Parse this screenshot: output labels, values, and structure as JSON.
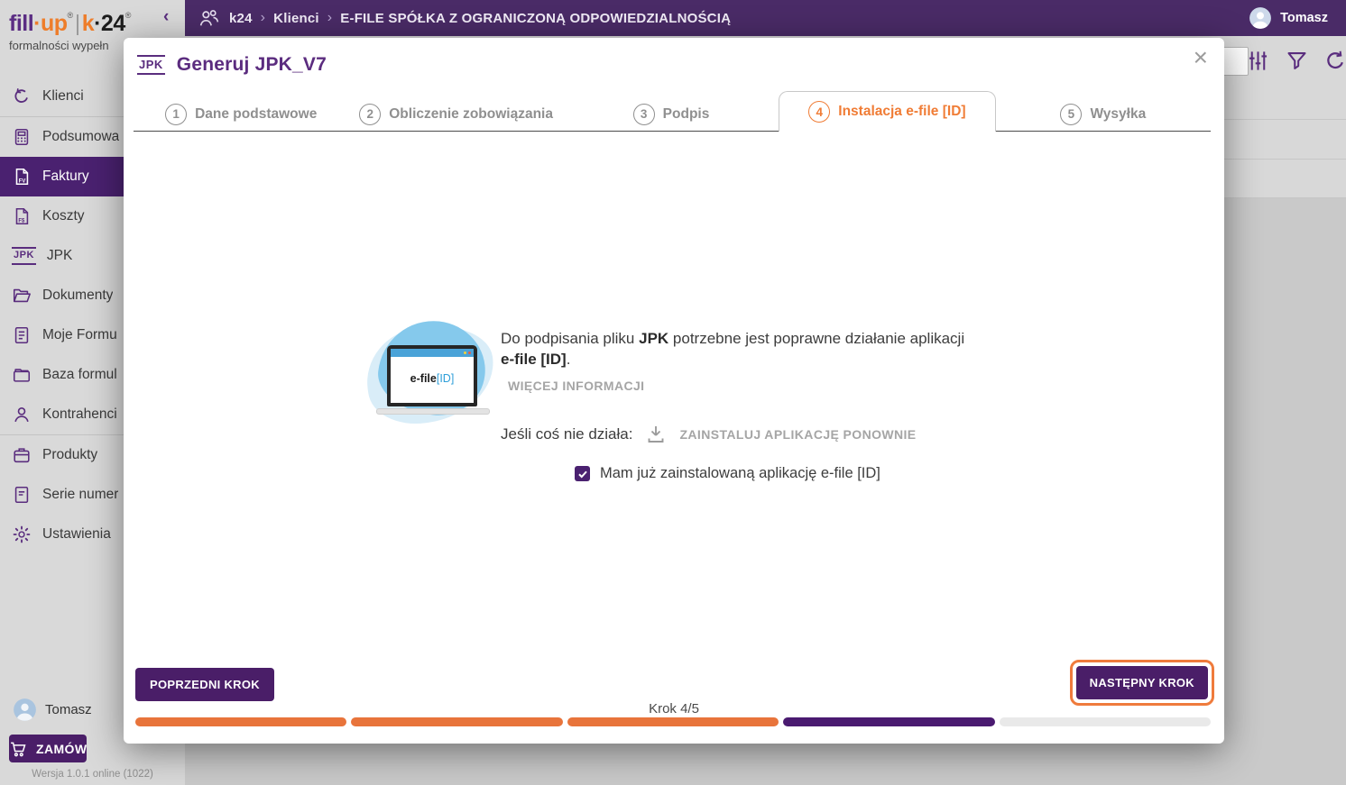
{
  "logo": {
    "brand1_a": "fill",
    "brand1_b": "·up",
    "reg": "®",
    "divider": "|",
    "brand2_a": "k",
    "brand2_b": "·24",
    "tagline": "formalności wypełn",
    "collapse_glyph": "‹"
  },
  "topbar": {
    "breadcrumb": {
      "root": "k24",
      "sep": "›",
      "section": "Klienci",
      "entity": "E-FILE SPÓŁKA Z OGRANICZONĄ ODPOWIEDZIALNOŚCIĄ"
    },
    "user_name": "Tomasz"
  },
  "sidebar": {
    "items": [
      {
        "label": "Klienci"
      },
      {
        "label": "Podsumowa"
      },
      {
        "label": "Faktury"
      },
      {
        "label": "Koszty"
      },
      {
        "label": "JPK"
      },
      {
        "label": "Dokumenty"
      },
      {
        "label": "Moje Formu"
      },
      {
        "label": "Baza formul"
      },
      {
        "label": "Kontrahenci"
      },
      {
        "label": "Produkty"
      },
      {
        "label": "Serie numer"
      },
      {
        "label": "Ustawienia"
      }
    ],
    "jpk_glyph": "JPK",
    "user_name": "Tomasz",
    "order_button": "ZAMÓW",
    "version": "Wersja 1.0.1 online (1022)"
  },
  "modal": {
    "icon_text": "JPK",
    "title": "Generuj JPK_V7",
    "close_glyph": "×",
    "steps": [
      {
        "num": "1",
        "label": "Dane podstawowe"
      },
      {
        "num": "2",
        "label": "Obliczenie zobowiązania"
      },
      {
        "num": "3",
        "label": "Podpis"
      },
      {
        "num": "4",
        "label": "Instalacja e-file [ID]"
      },
      {
        "num": "5",
        "label": "Wysyłka"
      }
    ],
    "content": {
      "intro_1": "Do podpisania pliku ",
      "intro_bold_1": "JPK",
      "intro_2": " potrzebne jest poprawne działanie aplikacji ",
      "intro_bold_2": "e-file [ID]",
      "intro_3": ".",
      "more_info_link": "WIĘCEJ INFORMACJI",
      "not_working_label": "Jeśli coś nie działa:",
      "reinstall_link": "ZAINSTALUJ APLIKACJĘ PONOWNIE",
      "checkbox_label": "Mam już zainstalowaną aplikację e-file [ID]",
      "laptop_brand_a": "e-file",
      "laptop_brand_b": "[ID]"
    },
    "footer": {
      "prev_button": "POPRZEDNI KROK",
      "next_button": "NASTĘPNY KROK",
      "step_indicator": "Krok 4/5",
      "progress_current": 4,
      "progress_total": 5
    }
  },
  "colors": {
    "topbar_purple": "#4a2b67",
    "button_purple": "#4a1e68",
    "active_item_purple": "#4a2170",
    "accent_orange": "#f07c35",
    "progress_done_orange": "#e8743b",
    "progress_current_purple": "#4a1a70",
    "link_gray": "#a5a5a5"
  }
}
